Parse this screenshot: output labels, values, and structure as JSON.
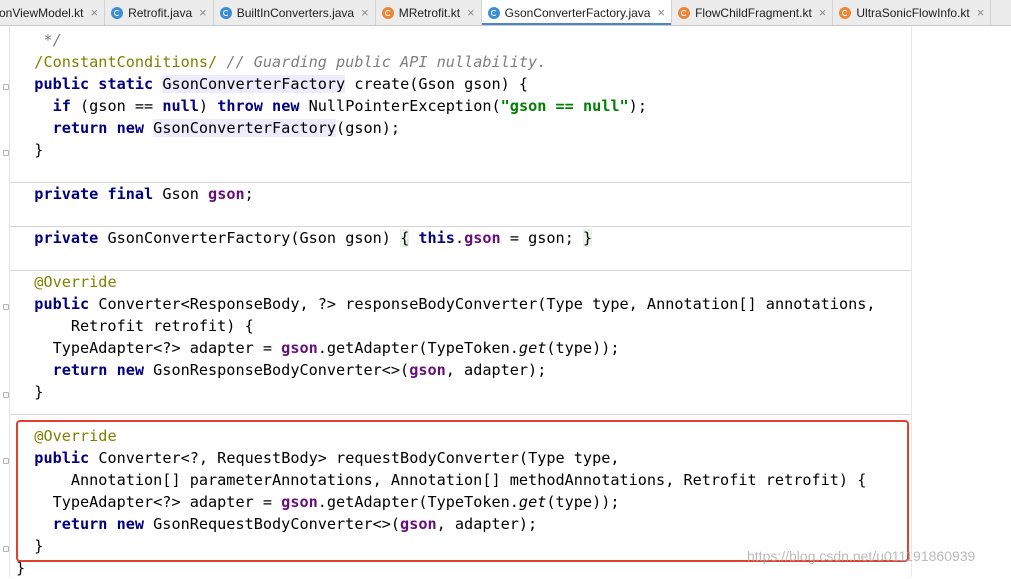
{
  "tabs": [
    {
      "label": "onViewModel.kt",
      "type": "kt",
      "active": false
    },
    {
      "label": "Retrofit.java",
      "type": "java",
      "active": false
    },
    {
      "label": "BuiltInConverters.java",
      "type": "java",
      "active": false
    },
    {
      "label": "MRetrofit.kt",
      "type": "kt",
      "active": false
    },
    {
      "label": "GsonConverterFactory.java",
      "type": "java",
      "active": true
    },
    {
      "label": "FlowChildFragment.kt",
      "type": "kt",
      "active": false
    },
    {
      "label": "UltraSonicFlowInfo.kt",
      "type": "kt",
      "active": false
    }
  ],
  "close_glyph": "×",
  "editor": {
    "lines": [
      {
        "tokens": [
          {
            "t": "   */",
            "c": "cm"
          }
        ]
      },
      {
        "tokens": [
          {
            "t": "  "
          },
          {
            "t": "/ConstantConditions/",
            "c": "ann"
          },
          {
            "t": " // Guarding public API nullability.",
            "c": "cm"
          }
        ]
      },
      {
        "tokens": [
          {
            "t": "  "
          },
          {
            "t": "public static",
            "c": "kw"
          },
          {
            "t": " "
          },
          {
            "t": "GsonConverterFactory",
            "c": "hl"
          },
          {
            "t": " create(Gson gson) {"
          }
        ]
      },
      {
        "tokens": [
          {
            "t": "    "
          },
          {
            "t": "if",
            "c": "kw"
          },
          {
            "t": " (gson == "
          },
          {
            "t": "null",
            "c": "kw"
          },
          {
            "t": ") "
          },
          {
            "t": "throw new",
            "c": "kw"
          },
          {
            "t": " NullPointerException("
          },
          {
            "t": "\"gson == null\"",
            "c": "str"
          },
          {
            "t": ");"
          }
        ]
      },
      {
        "tokens": [
          {
            "t": "    "
          },
          {
            "t": "return new",
            "c": "kw"
          },
          {
            "t": " "
          },
          {
            "t": "GsonConverterFactory",
            "c": "hl"
          },
          {
            "t": "(gson);"
          }
        ]
      },
      {
        "tokens": [
          {
            "t": "  }"
          }
        ]
      },
      {
        "tokens": []
      },
      {
        "tokens": [
          {
            "t": "  "
          },
          {
            "t": "private final",
            "c": "kw"
          },
          {
            "t": " Gson "
          },
          {
            "t": "gson",
            "c": "fld"
          },
          {
            "t": ";"
          }
        ]
      },
      {
        "tokens": []
      },
      {
        "tokens": [
          {
            "t": "  "
          },
          {
            "t": "private",
            "c": "kw"
          },
          {
            "t": " GsonConverterFactory(Gson gson) "
          },
          {
            "t": "{",
            "c": "brc"
          },
          {
            "t": " "
          },
          {
            "t": "this",
            "c": "kw"
          },
          {
            "t": "."
          },
          {
            "t": "gson",
            "c": "fld"
          },
          {
            "t": " = gson; "
          },
          {
            "t": "}",
            "c": "brc"
          }
        ]
      },
      {
        "tokens": []
      },
      {
        "tokens": [
          {
            "t": "  "
          },
          {
            "t": "@Override",
            "c": "ann"
          }
        ]
      },
      {
        "tokens": [
          {
            "t": "  "
          },
          {
            "t": "public",
            "c": "kw"
          },
          {
            "t": " Converter<ResponseBody, ?> responseBodyConverter(Type type, Annotation[] annotations,"
          }
        ]
      },
      {
        "tokens": [
          {
            "t": "      Retrofit retrofit) {"
          }
        ]
      },
      {
        "tokens": [
          {
            "t": "    TypeAdapter<?> adapter = "
          },
          {
            "t": "gson",
            "c": "fld"
          },
          {
            "t": ".getAdapter(TypeToken."
          },
          {
            "t": "get",
            "c": "it"
          },
          {
            "t": "(type));"
          }
        ]
      },
      {
        "tokens": [
          {
            "t": "    "
          },
          {
            "t": "return new",
            "c": "kw"
          },
          {
            "t": " GsonResponseBodyConverter<>("
          },
          {
            "t": "gson",
            "c": "fld"
          },
          {
            "t": ", adapter);"
          }
        ]
      },
      {
        "tokens": [
          {
            "t": "  }"
          }
        ]
      },
      {
        "tokens": []
      },
      {
        "tokens": [
          {
            "t": "  "
          },
          {
            "t": "@Override",
            "c": "ann"
          }
        ]
      },
      {
        "tokens": [
          {
            "t": "  "
          },
          {
            "t": "public",
            "c": "kw"
          },
          {
            "t": " Converter<?, RequestBody> requestBodyConverter(Type type,"
          }
        ]
      },
      {
        "tokens": [
          {
            "t": "      Annotation[] parameterAnnotations, Annotation[] methodAnnotations, Retrofit retrofit) {"
          }
        ]
      },
      {
        "tokens": [
          {
            "t": "    TypeAdapter<?> adapter = "
          },
          {
            "t": "gson",
            "c": "fld"
          },
          {
            "t": ".getAdapter(TypeToken."
          },
          {
            "t": "get",
            "c": "it"
          },
          {
            "t": "(type));"
          }
        ]
      },
      {
        "tokens": [
          {
            "t": "    "
          },
          {
            "t": "return new",
            "c": "kw"
          },
          {
            "t": " GsonRequestBodyConverter<>("
          },
          {
            "t": "gson",
            "c": "fld"
          },
          {
            "t": ", adapter);"
          }
        ]
      },
      {
        "tokens": [
          {
            "t": "  }"
          }
        ]
      },
      {
        "tokens": [
          {
            "t": "}"
          }
        ]
      }
    ]
  },
  "watermark": "https://blog.csdn.net/u011191860939",
  "colors": {
    "keyword": "#000080",
    "comment": "#808080",
    "annotation": "#808000",
    "field": "#660e7a",
    "string": "#008000",
    "highlight_box": "#e0402f",
    "active_tab_underline": "#4a88c7"
  }
}
